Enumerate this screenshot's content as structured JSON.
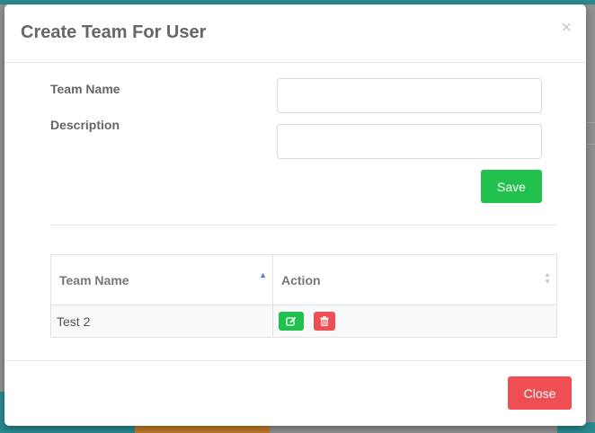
{
  "modal": {
    "title": "Create Team For User",
    "close_symbol": "×"
  },
  "form": {
    "team_name_label": "Team Name",
    "team_name_value": "",
    "description_label": "Description",
    "description_value": "",
    "save_label": "Save"
  },
  "table": {
    "columns": [
      "Team Name",
      "Action"
    ],
    "rows": [
      {
        "team_name": "Test 2",
        "actions": [
          "edit-icon",
          "trash-icon"
        ]
      }
    ]
  },
  "footer": {
    "close_label": "Close"
  },
  "colors": {
    "save": "#22c14d",
    "close": "#ef4f52",
    "edit": "#22c14d",
    "delete": "#ef4f52",
    "sort_active": "#6677cc"
  }
}
